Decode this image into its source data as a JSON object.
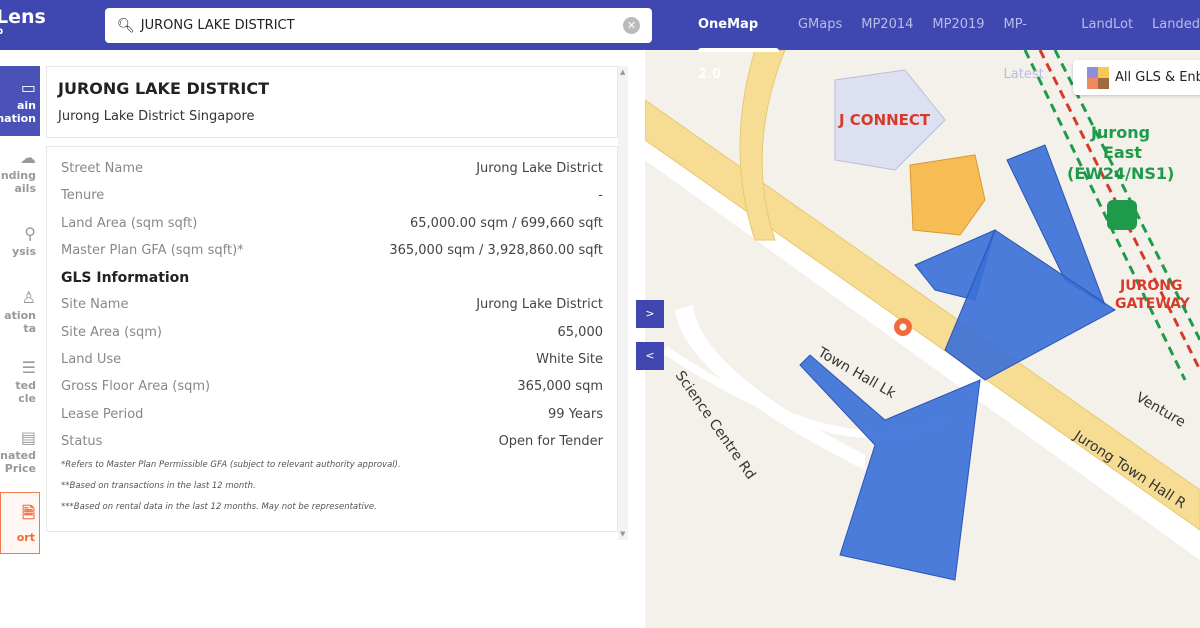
{
  "header": {
    "logo": "Lens",
    "logo_sub": "p",
    "search_value": "JURONG LAKE DISTRICT",
    "tabs": [
      {
        "label": "OneMap 2.0",
        "active": true
      },
      {
        "label": "GMaps"
      },
      {
        "label": "MP2014"
      },
      {
        "label": "MP2019"
      },
      {
        "label": "MP-Latest"
      },
      {
        "label": "LandLot"
      },
      {
        "label": "Landed"
      }
    ]
  },
  "sidebar": {
    "items": [
      {
        "label1": "ain",
        "label2": "mation",
        "icon": "info-card-icon",
        "active": true
      },
      {
        "label1": "nding",
        "label2": "ails",
        "icon": "surrounding-icon"
      },
      {
        "label1": "",
        "label2": "ysis",
        "icon": "analysis-icon"
      },
      {
        "label1": "ation",
        "label2": "ta",
        "icon": "valuation-icon"
      },
      {
        "label1": "ted",
        "label2": "cle",
        "icon": "article-icon"
      },
      {
        "label1": "nated",
        "label2": "g Price",
        "icon": "price-icon"
      },
      {
        "label1": "",
        "label2": "ort",
        "icon": "report-icon"
      }
    ]
  },
  "panel": {
    "title": "JURONG LAKE DISTRICT",
    "subtitle": "Jurong Lake District Singapore",
    "rows": [
      {
        "label": "Street Name",
        "value": "Jurong Lake District"
      },
      {
        "label": "Tenure",
        "value": "-"
      },
      {
        "label": "Land Area (sqm sqft)",
        "value": "65,000.00 sqm / 699,660 sqft"
      },
      {
        "label": "Master Plan GFA (sqm sqft)*",
        "value": "365,000 sqm / 3,928,860.00 sqft"
      }
    ],
    "gls_heading": "GLS Information",
    "gls_rows": [
      {
        "label": "Site Name",
        "value": "Jurong Lake District"
      },
      {
        "label": "Site Area (sqm)",
        "value": "65,000"
      },
      {
        "label": "Land Use",
        "value": "White Site"
      },
      {
        "label": "Gross Floor Area (sqm)",
        "value": "365,000 sqm"
      },
      {
        "label": "Lease Period",
        "value": "99 Years"
      },
      {
        "label": "Status",
        "value": "Open for Tender"
      }
    ],
    "notes": [
      "*Refers to Master Plan Permissible GFA (subject to relevant authority approval).",
      "**Based on transactions in the last 12 month.",
      "***Based on rental data in the last 12 months. May not be representative."
    ]
  },
  "map": {
    "legend": "All GLS & Enbl",
    "expand": ">",
    "collapse": "<",
    "labels": {
      "jconnect": "J CONNECT",
      "jurong": "Jurong",
      "east": "East",
      "code": "(EW24/NS1)",
      "gateway1": "JURONG",
      "gateway2": "GATEWAY",
      "townhall": "Town Hall Lk",
      "science": "Science Centre Rd",
      "jtr": "Jurong Town Hall R",
      "venture": "Venture"
    }
  },
  "colors": {
    "header": "#3f47b0",
    "polygon": "#3a6fd8",
    "accent": "#f06a3a"
  }
}
